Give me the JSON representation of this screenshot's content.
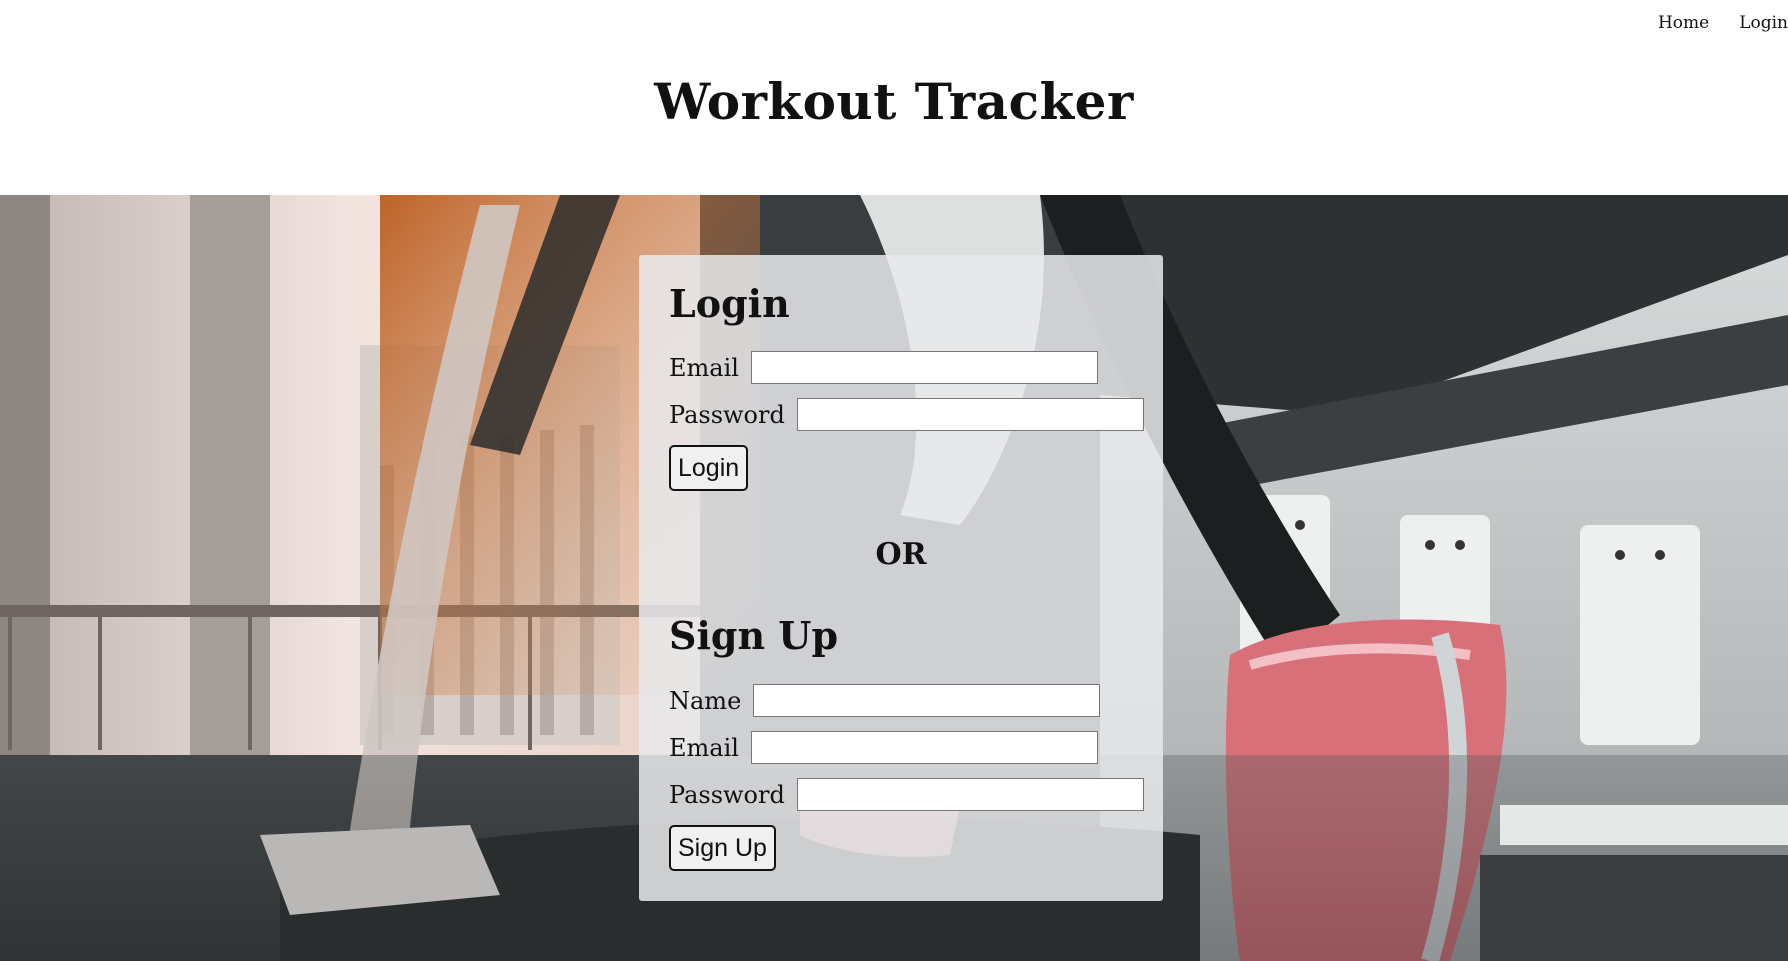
{
  "nav": {
    "items": [
      {
        "label": "Home"
      },
      {
        "label": "Login"
      }
    ]
  },
  "header": {
    "title": "Workout Tracker"
  },
  "login": {
    "heading": "Login",
    "email_label": "Email",
    "email_value": "",
    "password_label": "Password",
    "password_value": "",
    "button_label": "Login"
  },
  "divider": {
    "text": "OR"
  },
  "signup": {
    "heading": "Sign Up",
    "name_label": "Name",
    "name_value": "",
    "email_label": "Email",
    "email_value": "",
    "password_label": "Password",
    "password_value": "",
    "button_label": "Sign Up"
  },
  "colors": {
    "panel": "#e8e9eb",
    "button": "#f0f0f0",
    "text": "#111111"
  }
}
